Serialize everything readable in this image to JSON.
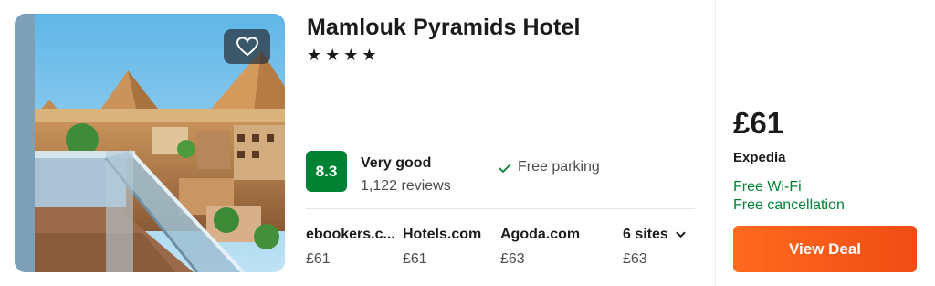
{
  "hotel": {
    "name": "Mamlouk Pyramids Hotel",
    "stars_text": "★★★★",
    "star_rating": 4,
    "image_alt": "hotel-balcony-pyramids-photo",
    "favorite_icon": "heart-outline-icon"
  },
  "rating": {
    "score": "8.3",
    "label": "Very good",
    "reviews": "1,122 reviews",
    "color": "#008234"
  },
  "amenities": [
    {
      "label": "Free parking",
      "icon": "check-icon"
    }
  ],
  "sites": [
    {
      "name": "ebookers.c...",
      "price": "£61"
    },
    {
      "name": "Hotels.com",
      "price": "£61"
    },
    {
      "name": "Agoda.com",
      "price": "£63"
    }
  ],
  "more_sites": {
    "label": "6 sites",
    "price": "£63",
    "icon": "chevron-down-icon"
  },
  "deal": {
    "price": "£61",
    "provider": "Expedia",
    "perks": [
      "Free Wi-Fi",
      "Free cancellation"
    ],
    "button_label": "View Deal",
    "button_color": "#ff6a1f",
    "perk_color": "#008234"
  }
}
